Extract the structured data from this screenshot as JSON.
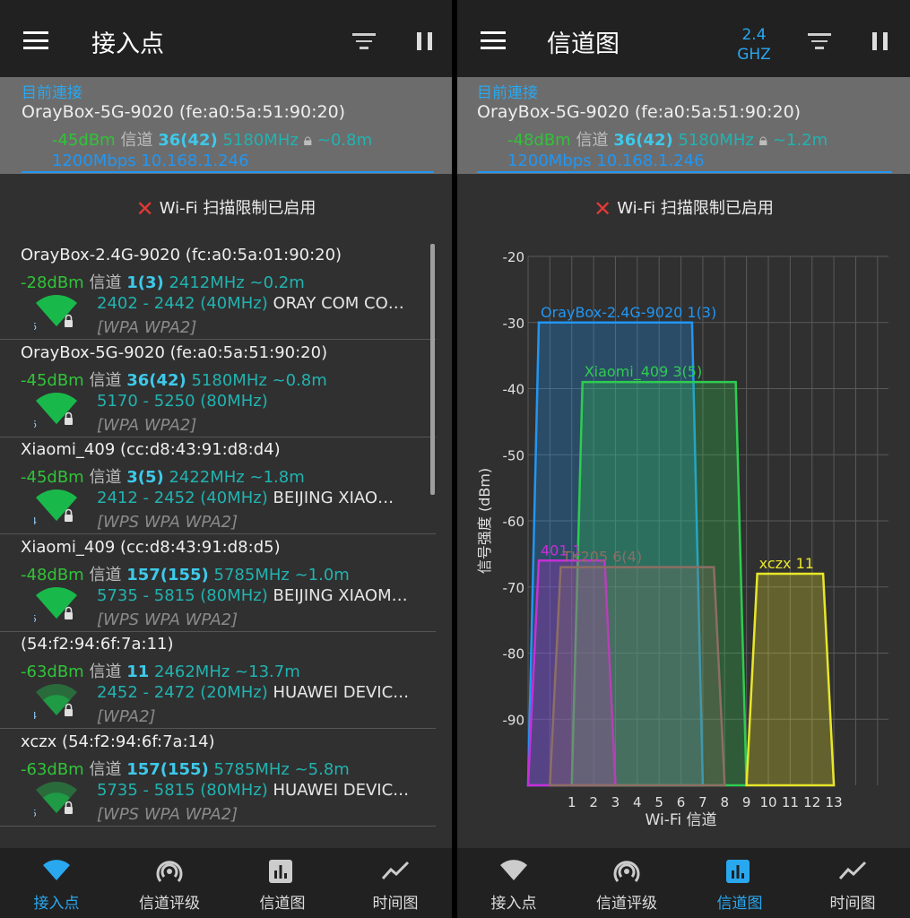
{
  "left": {
    "title": "接入点",
    "current": {
      "header": "目前連接",
      "ssid": "OrayBox-5G-9020 (fe:a0:5a:51:90:20)",
      "dbm": "-45dBm",
      "ch_label": "信道",
      "channel": "36(42)",
      "freq": "5180MHz",
      "dist": "~0.8m",
      "speed_ip": "1200Mbps 10.168.1.246"
    },
    "warning": "Wi-Fi 扫描限制已启用",
    "aps": [
      {
        "ssid": "OrayBox-2.4G-9020 (fc:a0:5a:01:90:20)",
        "dbm": "-28dBm",
        "ch_label": "信道",
        "channel": "1(3)",
        "freq": "2412MHz ~0.2m",
        "range": "2402 - 2442 (40MHz)",
        "vendor": "ORAY COM CO…",
        "security": "[WPA WPA2]",
        "num": "6",
        "strength": 3
      },
      {
        "ssid": "OrayBox-5G-9020 (fe:a0:5a:51:90:20)",
        "dbm": "-45dBm",
        "ch_label": "信道",
        "channel": "36(42)",
        "freq": "5180MHz ~0.8m",
        "range": "5170 - 5250 (80MHz)",
        "vendor": "",
        "security": "[WPA WPA2]",
        "num": "6",
        "strength": 3
      },
      {
        "ssid": "Xiaomi_409 (cc:d8:43:91:d8:d4)",
        "dbm": "-45dBm",
        "ch_label": "信道",
        "channel": "3(5)",
        "freq": "2422MHz ~1.8m",
        "range": "2412 - 2452 (40MHz)",
        "vendor": "BEIJING XIAO…",
        "security": "[WPS WPA WPA2]",
        "num": "4",
        "strength": 3
      },
      {
        "ssid": "Xiaomi_409 (cc:d8:43:91:d8:d5)",
        "dbm": "-48dBm",
        "ch_label": "信道",
        "channel": "157(155)",
        "freq": "5785MHz ~1.0m",
        "range": "5735 - 5815 (80MHz)",
        "vendor": "BEIJING XIAOM…",
        "security": "[WPS WPA WPA2]",
        "num": "5",
        "strength": 3
      },
      {
        "ssid": " (54:f2:94:6f:7a:11)",
        "dbm": "-63dBm",
        "ch_label": "信道",
        "channel": "11",
        "freq": "2462MHz ~13.7m",
        "range": "2452 - 2472 (20MHz)",
        "vendor": "HUAWEI DEVIC…",
        "security": "[WPA2]",
        "num": "4",
        "strength": 2
      },
      {
        "ssid": "xczx (54:f2:94:6f:7a:14)",
        "dbm": "-63dBm",
        "ch_label": "信道",
        "channel": "157(155)",
        "freq": "5785MHz ~5.8m",
        "range": "5735 - 5815 (80MHz)",
        "vendor": "HUAWEI DEVIC…",
        "security": "[WPS WPA WPA2]",
        "num": "5",
        "strength": 2
      }
    ]
  },
  "right": {
    "title": "信道图",
    "band": {
      "line1": "2.4",
      "line2": "GHZ"
    },
    "current": {
      "header": "目前連接",
      "ssid": "OrayBox-5G-9020 (fe:a0:5a:51:90:20)",
      "dbm": "-48dBm",
      "ch_label": "信道",
      "channel": "36(42)",
      "freq": "5180MHz",
      "dist": "~1.2m",
      "speed_ip": "1200Mbps 10.168.1.246"
    },
    "warning": "Wi-Fi 扫描限制已启用"
  },
  "nav": [
    "接入点",
    "信道评级",
    "信道图",
    "时间图"
  ],
  "colors": {
    "accent": "#29a8f0",
    "green": "#30c338",
    "teal": "#21b3b0",
    "warn": "#e53935"
  },
  "chart_data": {
    "type": "area",
    "xlabel": "Wi-Fi 信道",
    "ylabel": "信号强度 (dBm)",
    "ylim": [
      -100,
      -20
    ],
    "yticks": [
      -20,
      -30,
      -40,
      -50,
      -60,
      -70,
      -80,
      -90
    ],
    "xticks": [
      1,
      2,
      3,
      4,
      5,
      6,
      7,
      8,
      9,
      10,
      11,
      12,
      13
    ],
    "grid": true,
    "series": [
      {
        "name": "OrayBox-2.4G-9020 1(3)",
        "center": 3,
        "width_channels": 8,
        "dbm": -30,
        "color": "#2196f3"
      },
      {
        "name": "Xiaomi_409 3(5)",
        "center": 5,
        "width_channels": 8,
        "dbm": -39,
        "color": "#2ecc50"
      },
      {
        "name": "401 1",
        "center": 1,
        "width_channels": 4,
        "dbm": -66,
        "color": "#c62fd6"
      },
      {
        "name": "TK205 6(4)",
        "center": 4,
        "width_channels": 8,
        "dbm": -67,
        "color": "#8d6e63"
      },
      {
        "name": "xczx 11",
        "center": 11,
        "width_channels": 4,
        "dbm": -68,
        "color": "#e8e62a"
      }
    ]
  }
}
